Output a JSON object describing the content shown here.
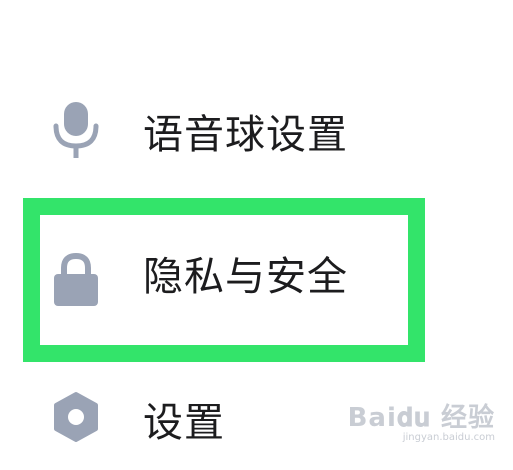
{
  "menu": {
    "items": [
      {
        "label": "语音球设置",
        "icon": "microphone-icon"
      },
      {
        "label": "隐私与安全",
        "icon": "lock-icon"
      },
      {
        "label": "设置",
        "icon": "hexagon-gear-icon"
      }
    ],
    "icon_color": "#9aa3b5",
    "highlight": {
      "item": "隐私与安全",
      "color": "#33e46a"
    }
  },
  "watermark": {
    "main": "Bai𝐝𝐮 经验",
    "sub": "jingyan.baidu.com"
  }
}
